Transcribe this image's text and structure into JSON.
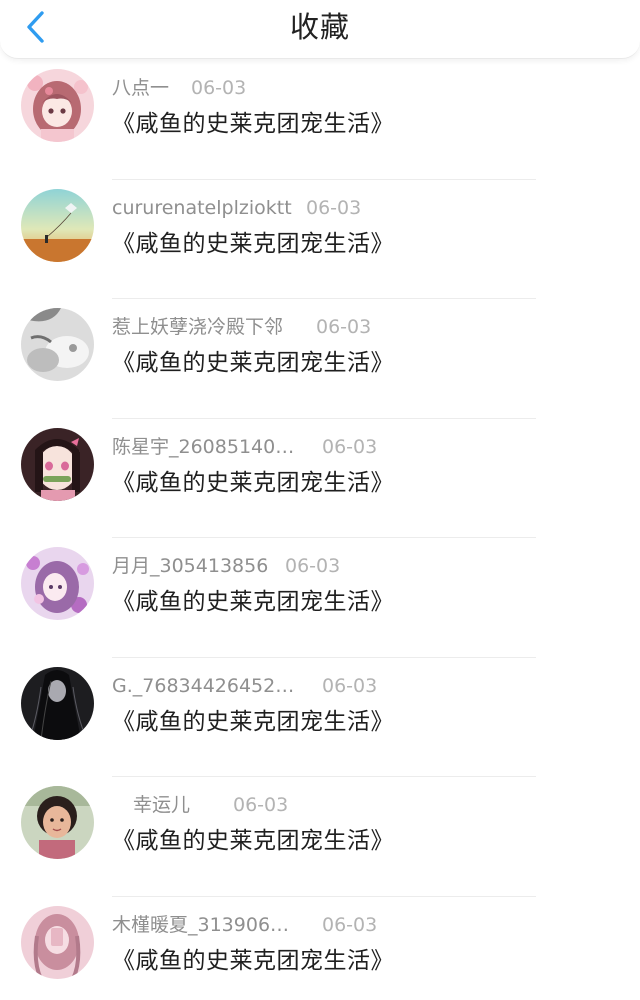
{
  "header": {
    "title": "收藏",
    "back_icon": "chevron-left-icon",
    "accent_color": "#2f9cf0"
  },
  "favorites": [
    {
      "name": "八点一",
      "date": "06-03",
      "book": "《咸鱼的史莱克团宠生活》",
      "avatar": "anime-girl-pink-hair-avatar"
    },
    {
      "name": "cururenatelplzioktt",
      "date": "06-03",
      "book": "《咸鱼的史莱克团宠生活》",
      "avatar": "kite-sunset-field-avatar"
    },
    {
      "name": "惹上妖孽浇冷殿下邻",
      "date": "06-03",
      "book": "《咸鱼的史莱克团宠生活》",
      "avatar": "grayscale-photo-avatar"
    },
    {
      "name": "陈星宇_26085140…",
      "date": "06-03",
      "book": "《咸鱼的史莱克团宠生活》",
      "avatar": "anime-girl-bamboo-muzzle-avatar"
    },
    {
      "name": "月月_305413856",
      "date": "06-03",
      "book": "《咸鱼的史莱克团宠生活》",
      "avatar": "anime-girl-purple-flowers-avatar"
    },
    {
      "name": "G._76834426452…",
      "date": "06-03",
      "book": "《咸鱼的史莱克团宠生活》",
      "avatar": "dark-long-hair-figure-avatar"
    },
    {
      "name": "幸运儿",
      "date": "06-03",
      "book": "《咸鱼的史莱克团宠生活》",
      "avatar": "child-photo-avatar"
    },
    {
      "name": "木槿暖夏_313906…",
      "date": "06-03",
      "book": "《咸鱼的史莱克团宠生活》",
      "avatar": "pink-tinted-girl-photo-avatar"
    }
  ]
}
